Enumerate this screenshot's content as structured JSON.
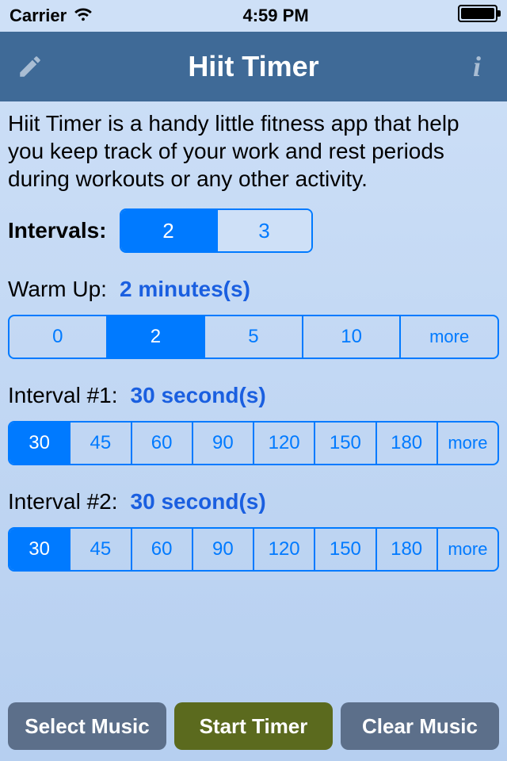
{
  "status": {
    "carrier": "Carrier",
    "time": "4:59 PM"
  },
  "nav": {
    "title": "Hiit Timer"
  },
  "description": "Hiit Timer is a handy little fitness app that help you keep track of your work and rest periods during workouts or any other activity.",
  "intervals": {
    "label": "Intervals:",
    "options": [
      "2",
      "3"
    ],
    "selected": "2"
  },
  "warmup": {
    "label": "Warm Up:",
    "value": "2 minutes(s)",
    "options": [
      "0",
      "2",
      "5",
      "10",
      "more"
    ],
    "selected": "2"
  },
  "interval1": {
    "label": "Interval #1:",
    "value": "30 second(s)",
    "options": [
      "30",
      "45",
      "60",
      "90",
      "120",
      "150",
      "180",
      "more"
    ],
    "selected": "30"
  },
  "interval2": {
    "label": "Interval #2:",
    "value": "30 second(s)",
    "options": [
      "30",
      "45",
      "60",
      "90",
      "120",
      "150",
      "180",
      "more"
    ],
    "selected": "30"
  },
  "buttons": {
    "select_music": "Select Music",
    "start_timer": "Start Timer",
    "clear_music": "Clear Music"
  }
}
